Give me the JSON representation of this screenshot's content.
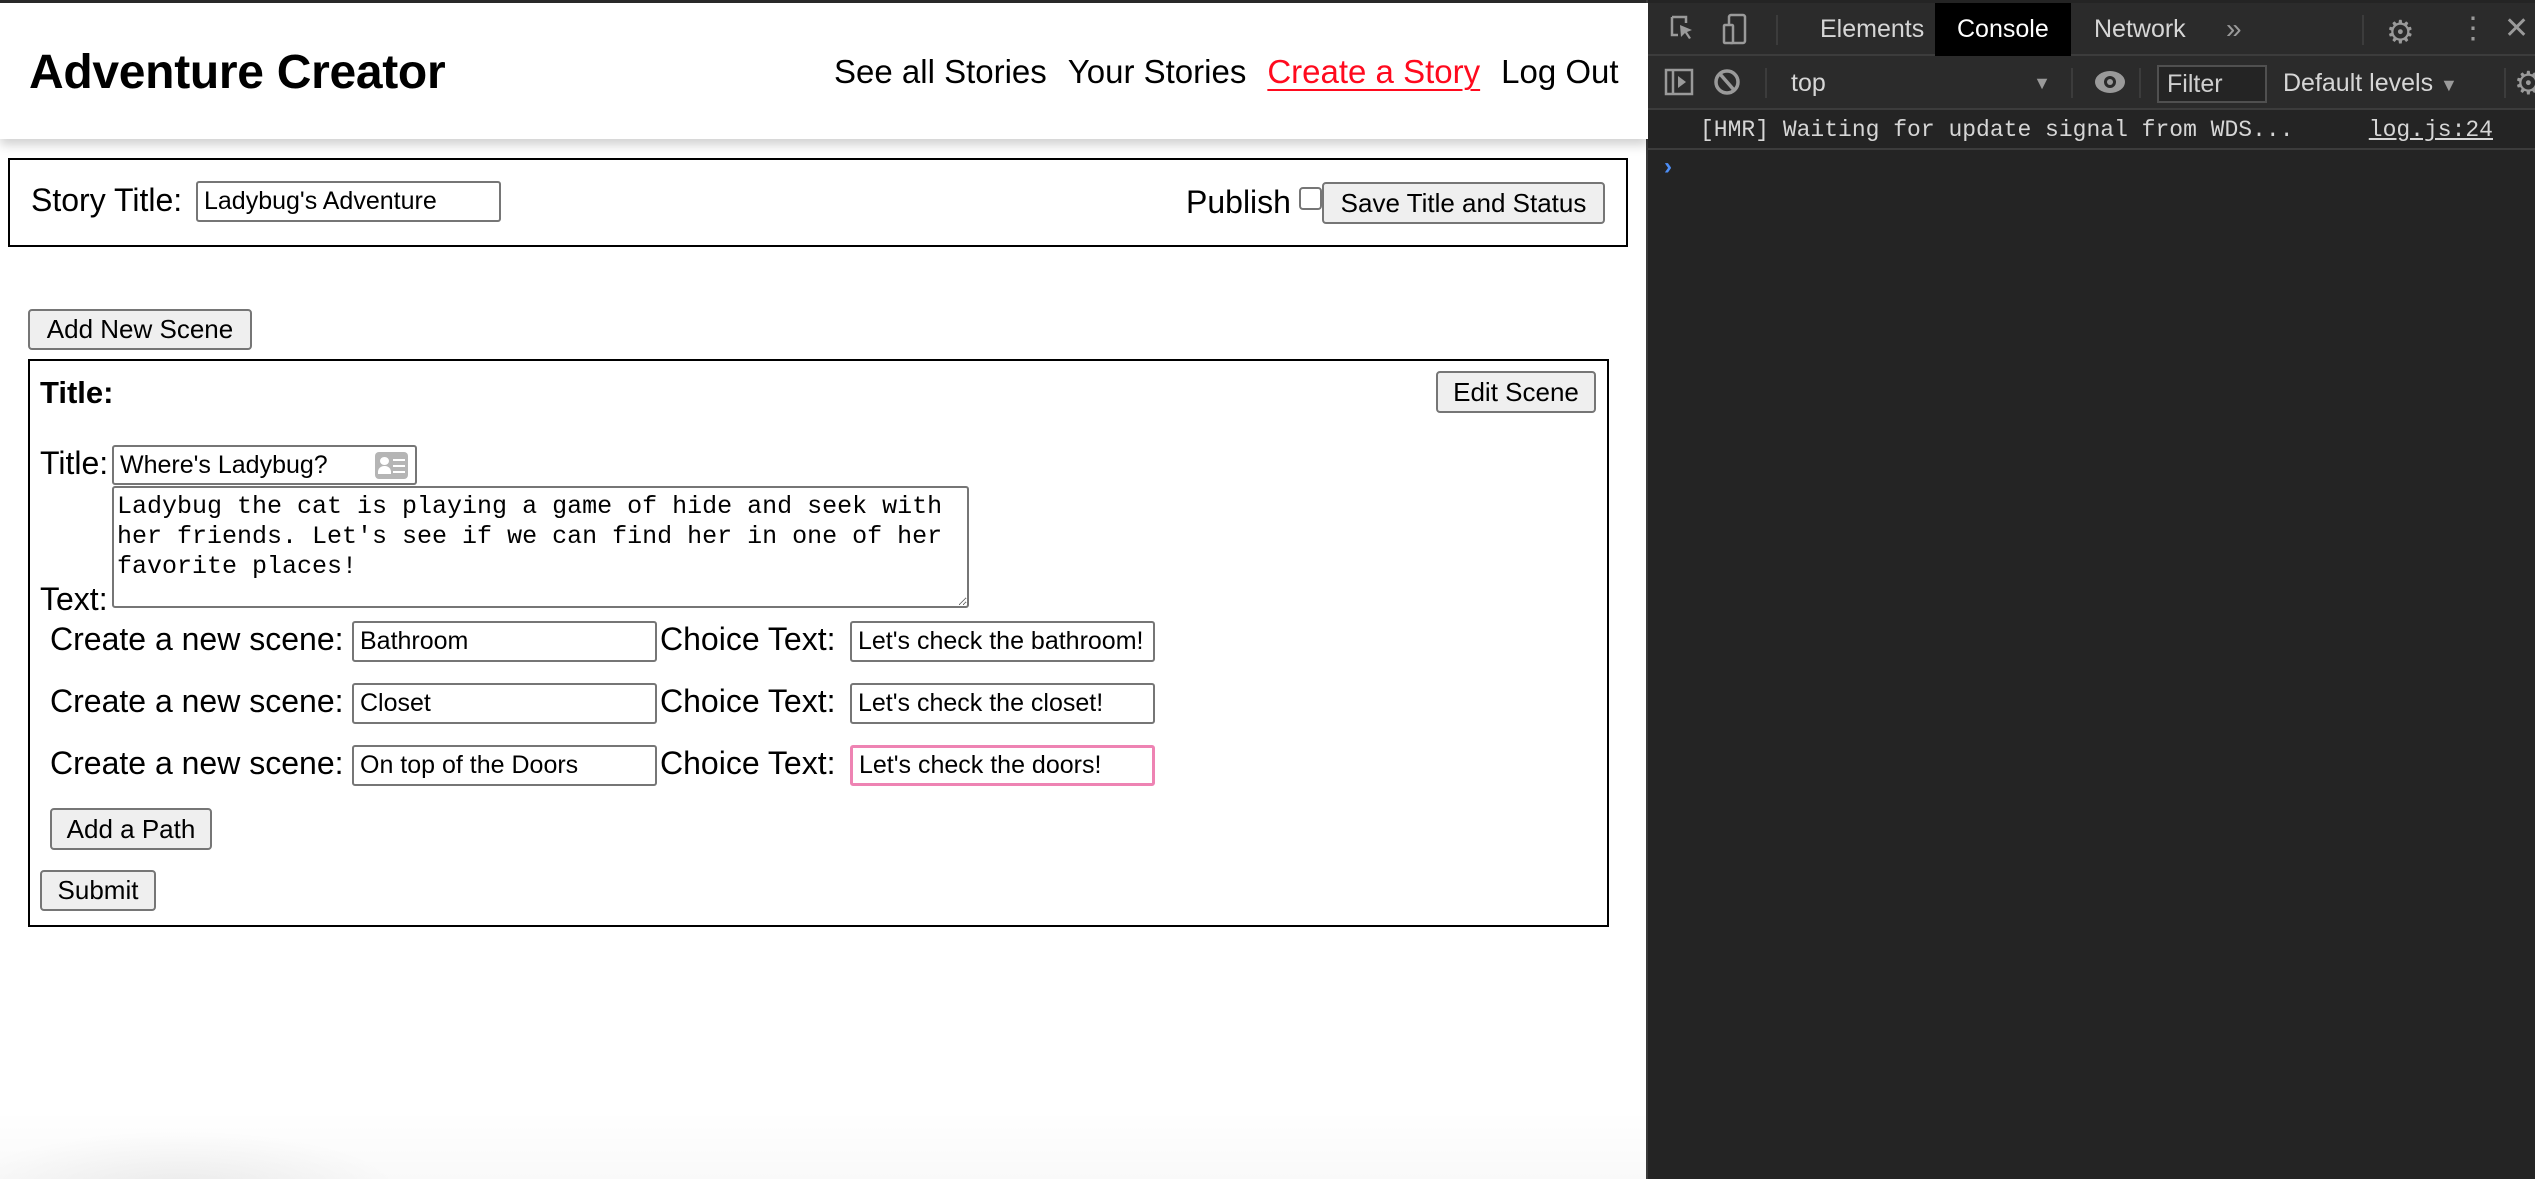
{
  "app": {
    "title": "Adventure Creator",
    "nav": [
      {
        "label": "See all Stories",
        "active": false
      },
      {
        "label": "Your Stories",
        "active": false
      },
      {
        "label": "Create a Story",
        "active": true
      },
      {
        "label": "Log Out",
        "active": false
      }
    ],
    "accent_color": "#ff0a1e"
  },
  "story": {
    "title_label": "Story Title:",
    "title_value": "Ladybug's Adventure",
    "publish_label": "Publish",
    "publish_checked": false,
    "save_button": "Save Title and Status"
  },
  "add_scene_button": "Add New Scene",
  "scene": {
    "heading": "Title:",
    "edit_button": "Edit Scene",
    "title_label": "Title:",
    "title_value": "Where's Ladybug?",
    "text_label": "Text:",
    "text_value": "Ladybug the cat is playing a game of hide and seek with her friends. Let's see if we can find her in one of her favorite places!",
    "paths": [
      {
        "scene_label": "Create a new scene:",
        "scene_value": "Bathroom",
        "choice_label": "Choice Text:",
        "choice_value": "Let's check the bathroom!"
      },
      {
        "scene_label": "Create a new scene:",
        "scene_value": "Closet",
        "choice_label": "Choice Text:",
        "choice_value": "Let's check the closet!"
      },
      {
        "scene_label": "Create a new scene:",
        "scene_value": "On top of the Doors",
        "choice_label": "Choice Text:",
        "choice_value": "Let's check the doors!"
      }
    ],
    "add_path_button": "Add a Path",
    "submit_button": "Submit",
    "focus_color": "#ee83b3"
  },
  "devtools": {
    "tabs": [
      {
        "label": "Elements",
        "active": false
      },
      {
        "label": "Console",
        "active": true
      },
      {
        "label": "Network",
        "active": false
      }
    ],
    "more_tabs_icon": "»",
    "context": "top",
    "filter_placeholder": "Filter",
    "levels": "Default levels",
    "log": {
      "message": "[HMR] Waiting for update signal from WDS...",
      "source": "log.js:24"
    },
    "prompt": "›"
  }
}
